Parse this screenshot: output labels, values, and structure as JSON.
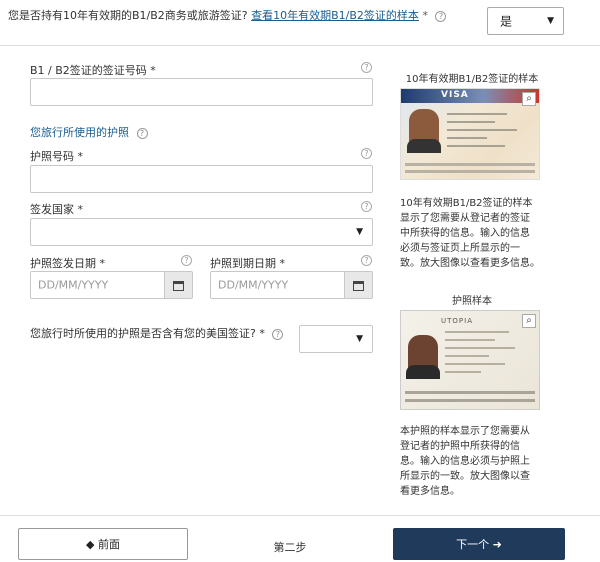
{
  "top_question": {
    "text": "您是否持有10年有效期的B1/B2商务或旅游签证?",
    "link": "查看10年有效期B1/B2签证的样本",
    "required": "*",
    "help": "?",
    "select_value": "是",
    "caret": "▼"
  },
  "form": {
    "visa_number_label": "B1 / B2签证的签证号码 *",
    "passport_section_label": "您旅行所使用的护照",
    "passport_number_label": "护照号码 *",
    "issuing_country_label": "签发国家 *",
    "issue_date_label": "护照签发日期 *",
    "expiry_date_label": "护照到期日期 *",
    "date_placeholder": "DD/MM/YYYY",
    "us_visa_question": "您旅行时所使用的护照是否含有您的美国签证? *",
    "help": "?",
    "caret": "▼"
  },
  "visa_sample": {
    "title": "10年有效期B1/B2签证的样本",
    "image_banner": "VISA",
    "description_lines": [
      "10年有效期B1/B2签证的样本",
      "显示了您需要从登记者的签证",
      "中所获得的信息。输入的信息",
      "必须与签证页上所显示的一",
      "致。放大图像以查看更多信息。"
    ]
  },
  "passport_sample": {
    "title": "护照样本",
    "image_header": "UTOPIA",
    "description_lines": [
      "本护照的样本显示了您需要从",
      "登记者的护照中所获得的信",
      "息。输入的信息必须与护照上",
      "所显示的一致。放大图像以查",
      "看更多信息。"
    ]
  },
  "footer": {
    "prev_label": "◆ 前面",
    "step_label": "第二步",
    "next_label": "下一个 ➜"
  },
  "icons": {
    "help": "help-icon",
    "calendar": "calendar-icon",
    "zoom": "magnifier-icon"
  },
  "colors": {
    "link": "#1a5d8f",
    "next_button": "#203a5c"
  }
}
